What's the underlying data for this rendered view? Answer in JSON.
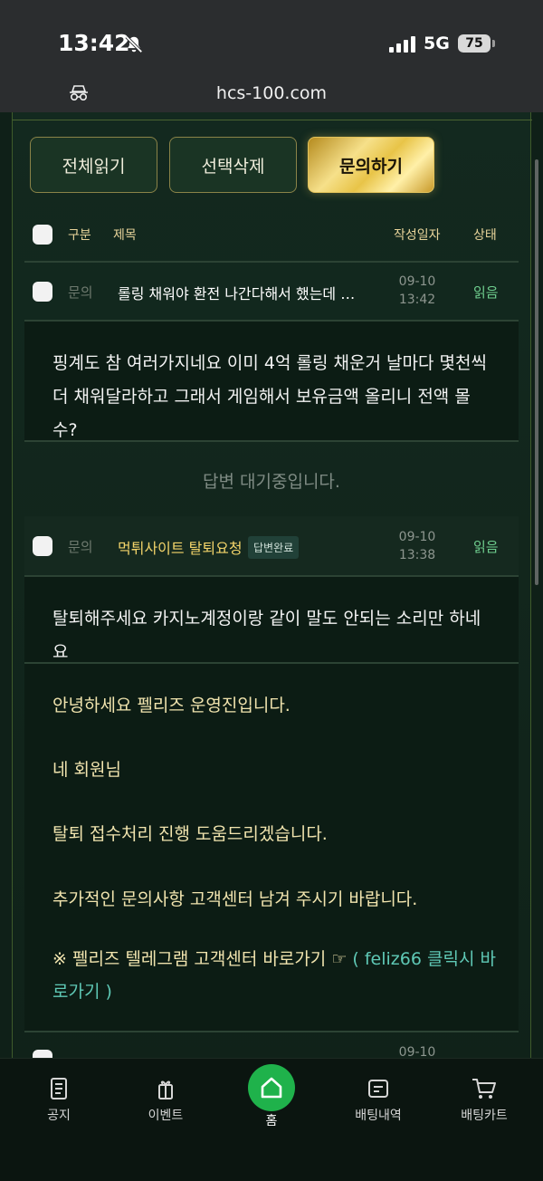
{
  "status_bar": {
    "time": "13:42",
    "network": "5G",
    "battery": "75"
  },
  "browser": {
    "url": "hcs-100.com"
  },
  "actions": {
    "read_all": "전체읽기",
    "delete_selected": "선택삭제",
    "inquire": "문의하기"
  },
  "table_header": {
    "category": "구분",
    "title": "제목",
    "date": "작성일자",
    "status": "상태"
  },
  "rows": [
    {
      "category": "문의",
      "title": "롤링 채워야 환전 나간다해서 했는데 …",
      "date": "09-10",
      "time": "13:42",
      "status": "읽음",
      "question_lines": [
        "핑계도 참 여러가지네요 이미 4억 롤링 채운거 날마다 몇천씩",
        "더 채워달라하고 그래서 게임해서 보유금액 올리니 전액 몰수?"
      ],
      "answer_waiting": "답변 대기중입니다."
    },
    {
      "category": "문의",
      "title": "먹튀사이트 탈퇴요청",
      "badge": "답변완료",
      "date": "09-10",
      "time": "13:38",
      "status": "읽음",
      "question": "탈퇴해주세요 카지노계정이랑 같이 말도 안되는 소리만 하네요",
      "answer": {
        "line1": "안녕하세요 펠리즈 운영진입니다.",
        "line2": "네 회원님",
        "line3": "탈퇴 접수처리 진행 도움드리겠습니다.",
        "line4": "추가적인 문의사항 고객센터 남겨 주시기 바랍니다.",
        "link_prefix": "※ 펠리즈 텔레그램 고객센터 바로가기 ☞",
        "link_text": "( feliz66 클릭시 바로가기 )"
      }
    },
    {
      "date": "09-10"
    }
  ],
  "bottom_nav": {
    "notice": "공지",
    "event": "이벤트",
    "home": "홈",
    "bet_history": "배팅내역",
    "bet_cart": "배팅카트"
  }
}
